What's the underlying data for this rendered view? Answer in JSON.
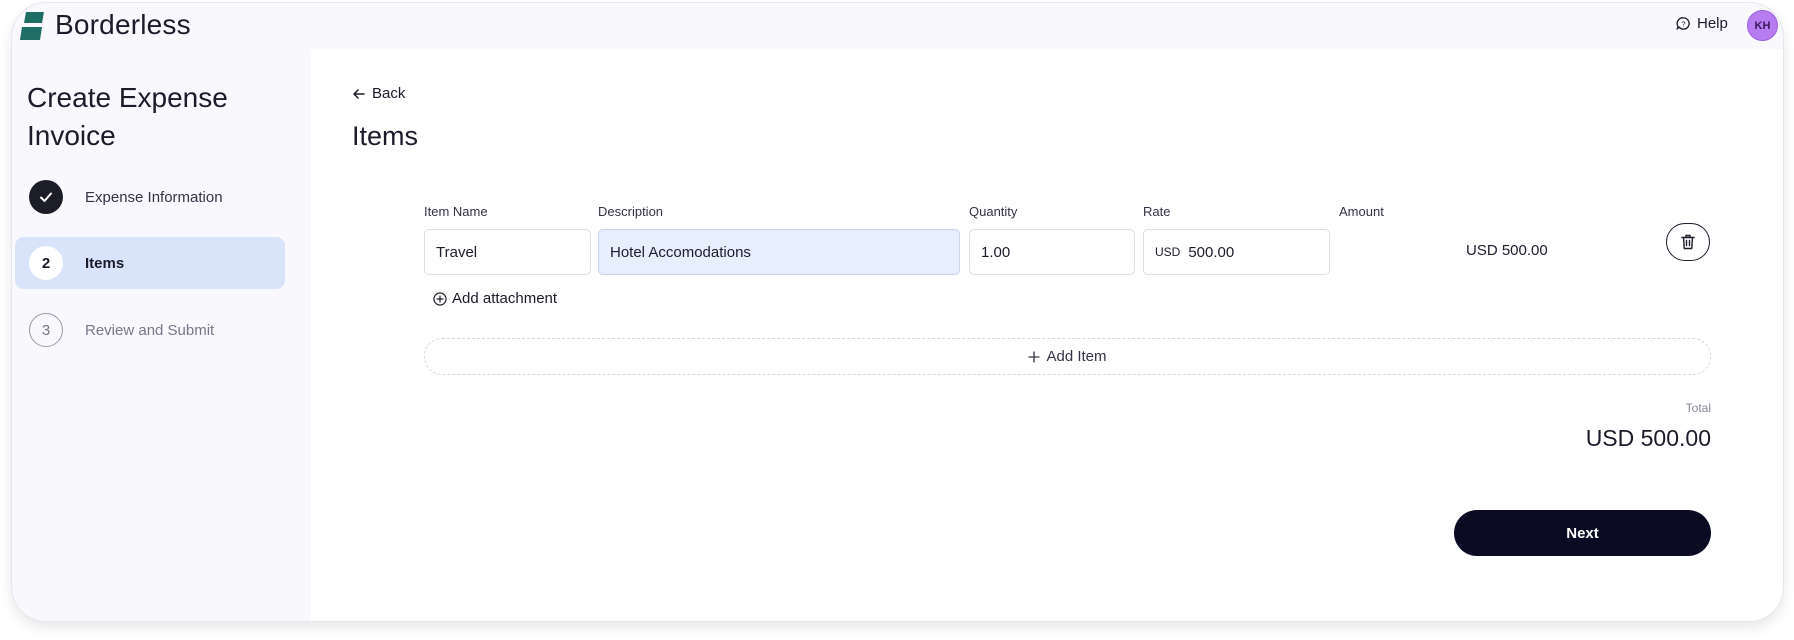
{
  "app": {
    "brand": "Borderless",
    "help_label": "Help",
    "avatar_initials": "KH",
    "colors": {
      "brand_green": "#1f6e66",
      "avatar_bg": "#b77cf0",
      "active_step_bg": "#d9e4fb",
      "primary_button": "#0c0b24"
    }
  },
  "sidebar": {
    "title": "Create Expense Invoice",
    "steps": [
      {
        "number": "",
        "icon": "check-icon",
        "label": "Expense Information",
        "state": "completed"
      },
      {
        "number": "2",
        "label": "Items",
        "state": "active"
      },
      {
        "number": "3",
        "label": "Review and Submit",
        "state": "pending"
      }
    ]
  },
  "main": {
    "back_label": "Back",
    "section_title": "Items",
    "columns": {
      "item_name": "Item Name",
      "description": "Description",
      "quantity": "Quantity",
      "rate": "Rate",
      "amount": "Amount"
    },
    "item": {
      "name": "Travel",
      "description": "Hotel Accomodations",
      "quantity": "1.00",
      "rate_currency": "USD",
      "rate": "500.00",
      "amount": "USD 500.00"
    },
    "add_attachment_label": "Add attachment",
    "add_item_label": "Add Item",
    "total_label": "Total",
    "total_value": "USD 500.00",
    "next_label": "Next"
  }
}
